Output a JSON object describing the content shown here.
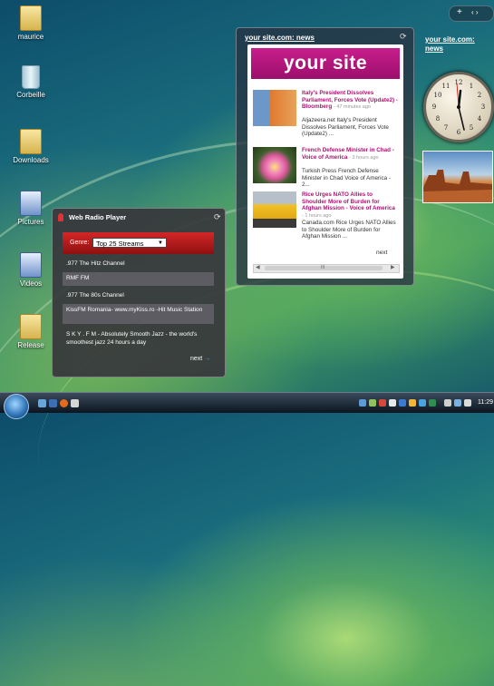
{
  "sidebar": {
    "add_label": "+",
    "nav_label": "‹ ›"
  },
  "desktop_icons": [
    {
      "label": "maurice"
    },
    {
      "label": "Corbeille"
    },
    {
      "label": "Downloads"
    },
    {
      "label": "Pictures"
    },
    {
      "label": "Videos"
    },
    {
      "label": "Release"
    }
  ],
  "news_gadget": {
    "title": "your site.com: news",
    "banner": "your site",
    "items": [
      {
        "headline": "Italy's President Dissolves Parliament, Forces Vote (Update2) - Bloomberg",
        "time": "- 47 minutes ago",
        "summary": "Aljazeera.net Italy's President Dissolves Parliament, Forces Vote (Update2) ..."
      },
      {
        "headline": "French Defense Minister in Chad - Voice of America",
        "time": "- 3 hours ago",
        "summary": "Turkish Press French Defense Minister in Chad Voice of America - 2..."
      },
      {
        "headline": "Rice Urges NATO Allies to Shoulder More of Burden for Afghan Mission - Voice of America",
        "time": "- 1 hours ago",
        "summary": "Canada.com Rice Urges NATO Allies to Shoulder More of Burden for Afghan Mission ..."
      }
    ],
    "next_label": "next",
    "scroll_center": "III"
  },
  "sidebar_link": {
    "line1": "your site.com:",
    "line2": "news"
  },
  "radio": {
    "title": "Web Radio Player",
    "genre_label": "Genre:",
    "genre_value": "Top 25 Streams",
    "stations": [
      ".977 The Hitz Channel",
      "RMF FM",
      ".977 The 80s Channel",
      "KissFM Romania- www.myKiss.ro -Hit Music Station",
      "S K Y . F M - Absolutely Smooth Jazz - the world's smoothest jazz 24 hours a day"
    ],
    "next_label": "next",
    "next_arrow": "→"
  },
  "taskbar": {
    "time": "11:29"
  }
}
